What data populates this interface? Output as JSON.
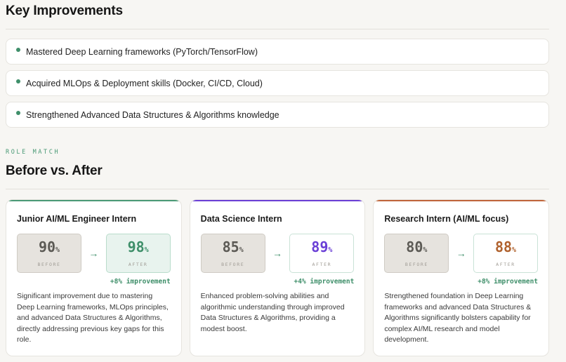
{
  "improvements": {
    "title": "Key Improvements",
    "items": [
      "Mastered Deep Learning frameworks (PyTorch/TensorFlow)",
      "Acquired MLOps & Deployment skills (Docker, CI/CD, Cloud)",
      "Strengthened Advanced Data Structures & Algorithms knowledge"
    ]
  },
  "role_match": {
    "eyebrow": "ROLE MATCH",
    "title": "Before vs. After",
    "before_label": "BEFORE",
    "after_label": "AFTER",
    "pct": "%",
    "arrow": "→",
    "cards": [
      {
        "title": "Junior AI/ML Engineer Intern",
        "before": "90",
        "after": "98",
        "delta": "+8% improvement",
        "accent": "#4a9a76",
        "after_color": "#3f8f6a",
        "after_bg": "#e8f3ee",
        "after_border": "#b9dccb",
        "desc": "Significant improvement due to mastering Deep Learning frameworks, MLOps principles, and advanced Data Structures & Algorithms, directly addressing previous key gaps for this role."
      },
      {
        "title": "Data Science Intern",
        "before": "85",
        "after": "89",
        "delta": "+4% improvement",
        "accent": "#6a3fd6",
        "after_color": "#6a3fd6",
        "after_bg": "#ffffff",
        "after_border": "#c9e2d6",
        "desc": "Enhanced problem-solving abilities and algorithmic understanding through improved Data Structures & Algorithms, providing a modest boost."
      },
      {
        "title": "Research Intern (AI/ML focus)",
        "before": "80",
        "after": "88",
        "delta": "+8% improvement",
        "accent": "#c0653a",
        "after_color": "#b0622e",
        "after_bg": "#ffffff",
        "after_border": "#c9e2d6",
        "desc": "Strengthened foundation in Deep Learning frameworks and advanced Data Structures & Algorithms significantly bolsters capability for complex AI/ML research and model development."
      }
    ]
  }
}
